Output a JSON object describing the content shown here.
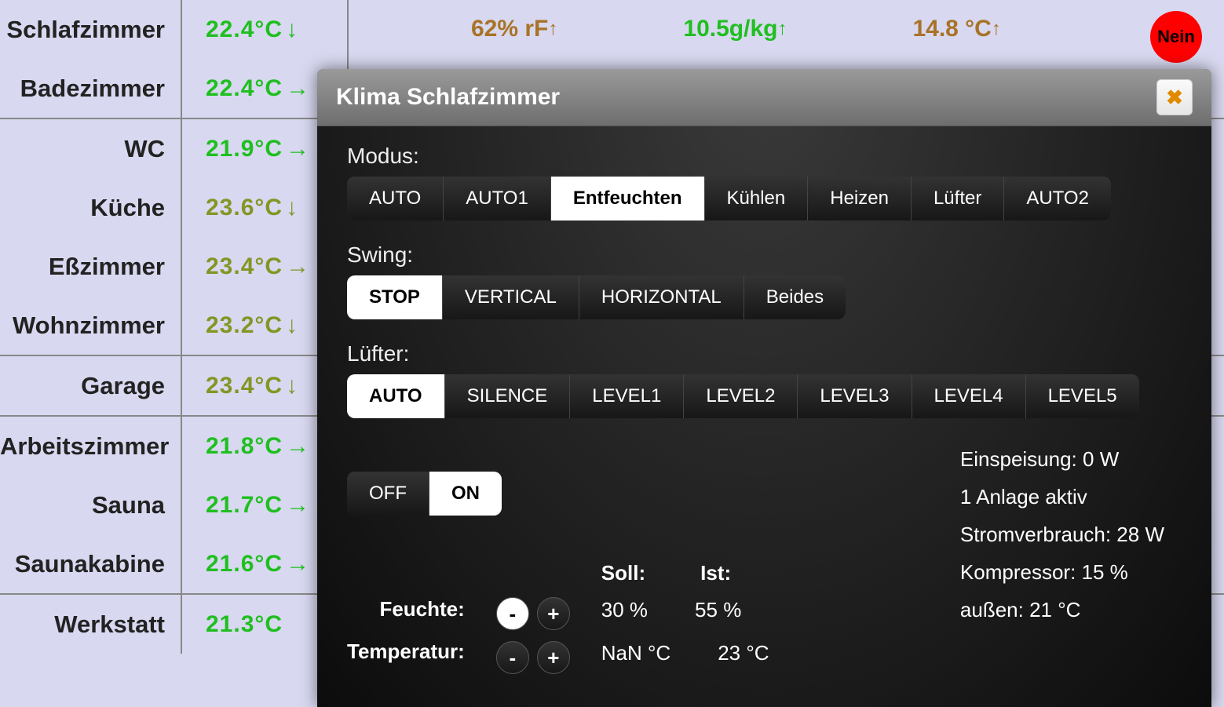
{
  "rooms": [
    {
      "name": "Schlafzimmer",
      "temp": "22.4°C",
      "arrow": "↓",
      "color": "c-green",
      "group_end": false
    },
    {
      "name": "Badezimmer",
      "temp": "22.4°C",
      "arrow": "→",
      "color": "c-green",
      "group_end": true
    },
    {
      "name": "WC",
      "temp": "21.9°C",
      "arrow": "→",
      "color": "c-green",
      "group_end": false
    },
    {
      "name": "Küche",
      "temp": "23.6°C",
      "arrow": "↓",
      "color": "c-olive",
      "group_end": false
    },
    {
      "name": "Eßzimmer",
      "temp": "23.4°C",
      "arrow": "→",
      "color": "c-olive",
      "group_end": false
    },
    {
      "name": "Wohnzimmer",
      "temp": "23.2°C",
      "arrow": "↓",
      "color": "c-olive",
      "group_end": true
    },
    {
      "name": "Garage",
      "temp": "23.4°C",
      "arrow": "↓",
      "color": "c-olive",
      "group_end": true
    },
    {
      "name": "Arbeitszimmer",
      "temp": "21.8°C",
      "arrow": "→",
      "color": "c-green",
      "group_end": false
    },
    {
      "name": "Sauna",
      "temp": "21.7°C",
      "arrow": "→",
      "color": "c-green",
      "group_end": false
    },
    {
      "name": "Saunakabine",
      "temp": "21.6°C",
      "arrow": "→",
      "color": "c-green",
      "group_end": true
    },
    {
      "name": "Werkstatt",
      "temp": "21.3°C",
      "arrow": "",
      "color": "c-green",
      "group_end": false
    }
  ],
  "toprow": {
    "humidity": "62% rF",
    "humidity_arrow": "↑",
    "abs": "10.5g/kg",
    "abs_arrow": "↑",
    "dew": "14.8 °C",
    "dew_arrow": "↑",
    "badge": "Nein"
  },
  "modal": {
    "title": "Klima Schlafzimmer",
    "close": "✖",
    "modus_label": "Modus:",
    "modus": [
      "AUTO",
      "AUTO1",
      "Entfeuchten",
      "Kühlen",
      "Heizen",
      "Lüfter",
      "AUTO2"
    ],
    "modus_active": "Entfeuchten",
    "swing_label": "Swing:",
    "swing": [
      "STOP",
      "VERTICAL",
      "HORIZONTAL",
      "Beides"
    ],
    "swing_active": "STOP",
    "fan_label": "Lüfter:",
    "fan": [
      "AUTO",
      "SILENCE",
      "LEVEL1",
      "LEVEL2",
      "LEVEL3",
      "LEVEL4",
      "LEVEL5"
    ],
    "fan_active": "AUTO",
    "power": [
      "OFF",
      "ON"
    ],
    "power_active": "ON",
    "soll_label": "Soll:",
    "ist_label": "Ist:",
    "feuchte_label": "Feuchte:",
    "feuchte_soll": "30 %",
    "feuchte_ist": "55 %",
    "temp_label": "Temperatur:",
    "temp_soll": "NaN °C",
    "temp_ist": "23 °C",
    "minus": "-",
    "plus": "+",
    "stats": {
      "einspeisung": "Einspeisung: 0 W",
      "anlagen": "1 Anlage aktiv",
      "strom": "Stromverbrauch: 28 W",
      "kompressor": "Kompressor: 15 %",
      "aussen": "außen: 21 °C"
    }
  }
}
